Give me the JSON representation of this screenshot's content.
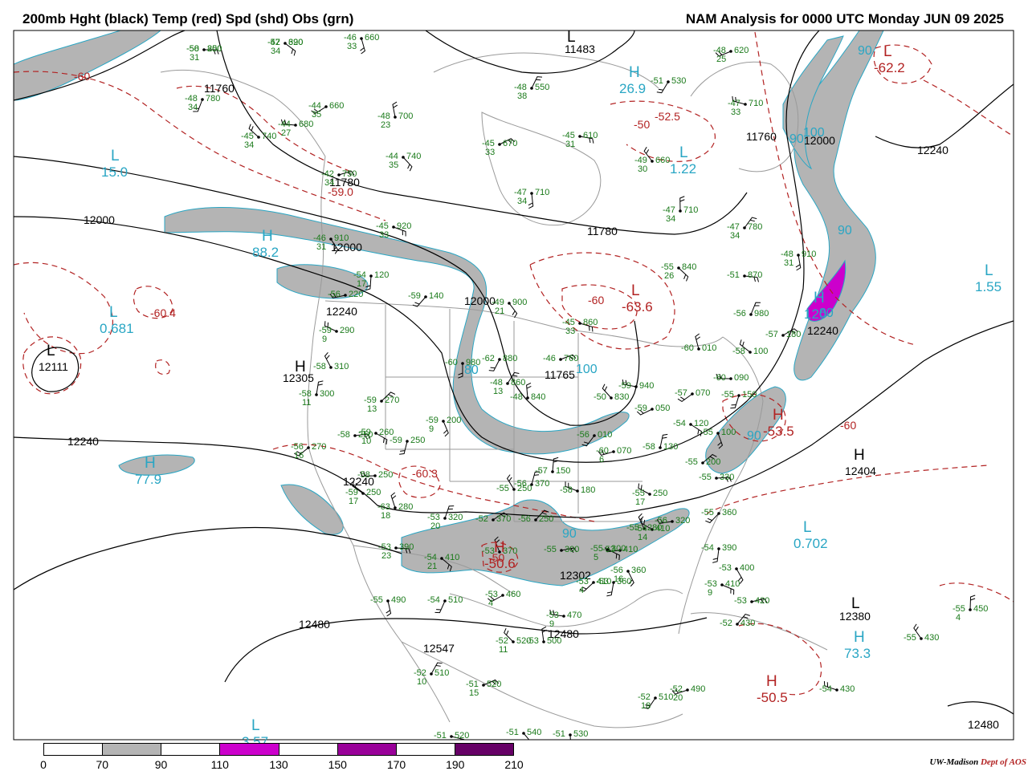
{
  "header": {
    "left": "200mb Hght (black) Temp (red) Spd (shd) Obs (grn)",
    "right": "NAM Analysis for 0000 UTC Monday  JUN 09 2025"
  },
  "legend": {
    "ticks": [
      "0",
      "70",
      "90",
      "110",
      "130",
      "150",
      "170",
      "190",
      "210"
    ],
    "fills": [
      "#ffffff",
      "#b4b4b4",
      "#ffffff",
      "#cc00cc",
      "#ffffff",
      "#990099",
      "#ffffff",
      "#660066"
    ]
  },
  "credit": {
    "org": "UW-Madison",
    "dept": "Dept of AOS"
  },
  "colors": {
    "height": "#000000",
    "temp": "#b22222",
    "speed": "#29a6c4",
    "obs": "#1a7a1a",
    "speed_shade": "#b4b4b4",
    "jet_core": "#cc00cc"
  },
  "height_labels": [
    "11483",
    "11760",
    "11760",
    "11780",
    "11780",
    "12000",
    "12000",
    "12000",
    "12000",
    "12240",
    "12240",
    "12240",
    "12240",
    "12240",
    "12480",
    "12480",
    "12480",
    "12111",
    "12305",
    "12404",
    "12547",
    "12380",
    "11765",
    "12302"
  ],
  "pressure_centers": [
    {
      "type": "H",
      "value": "26.9",
      "kind": "speed"
    },
    {
      "type": "L",
      "value": "15.0",
      "kind": "speed"
    },
    {
      "type": "H",
      "value": "88.2",
      "kind": "speed"
    },
    {
      "type": "L",
      "value": "0.681",
      "kind": "speed"
    },
    {
      "type": "H",
      "value": "77.9",
      "kind": "speed"
    },
    {
      "type": "L",
      "value": "1.22",
      "kind": "speed"
    },
    {
      "type": "L",
      "value": "1.55",
      "kind": "speed"
    },
    {
      "type": "L",
      "value": "0.702",
      "kind": "speed"
    },
    {
      "type": "H",
      "value": "73.3",
      "kind": "speed"
    },
    {
      "type": "H",
      "value": "120",
      "kind": "speed"
    },
    {
      "type": "L",
      "value": "3.57",
      "kind": "speed"
    },
    {
      "type": "L",
      "value": "",
      "kind": "height"
    },
    {
      "type": "H",
      "value": "",
      "kind": "height"
    },
    {
      "type": "H",
      "value": "",
      "kind": "height"
    },
    {
      "type": "L",
      "value": "",
      "kind": "height"
    },
    {
      "type": "L",
      "value": "",
      "kind": "height"
    },
    {
      "type": "L",
      "value": "-63.6",
      "kind": "temp"
    },
    {
      "type": "H",
      "value": "-53.5",
      "kind": "temp"
    },
    {
      "type": "H",
      "value": "-50.6",
      "kind": "temp"
    },
    {
      "type": "H",
      "value": "-50.5",
      "kind": "temp"
    },
    {
      "type": "L",
      "value": "-62.2",
      "kind": "temp"
    }
  ],
  "temp_labels": [
    "-60",
    "-52.5",
    "-50",
    "-60",
    "-60.4",
    "-59.0",
    "-60.3",
    "-60",
    "-50"
  ],
  "speed_labels": [
    "90",
    "90",
    "90",
    "100",
    "100",
    "90",
    "80",
    "80",
    "90"
  ],
  "observations": [
    {
      "t": "-50",
      "s": "31",
      "h": "800"
    },
    {
      "t": "-47",
      "s": "34",
      "h": "690"
    },
    {
      "t": "-46",
      "s": "33",
      "h": "660"
    },
    {
      "t": "-48",
      "s": "34",
      "h": "780"
    },
    {
      "t": "-44",
      "s": "35",
      "h": "660"
    },
    {
      "t": "-44",
      "s": "27",
      "h": "680"
    },
    {
      "t": "-45",
      "s": "34",
      "h": "740"
    },
    {
      "t": "-48",
      "s": "23",
      "h": "700"
    },
    {
      "t": "-48",
      "s": "38",
      "h": "550"
    },
    {
      "t": "-45",
      "s": "33",
      "h": "670"
    },
    {
      "t": "-45",
      "s": "31",
      "h": "610"
    },
    {
      "t": "-44",
      "s": "35",
      "h": "740"
    },
    {
      "t": "-47",
      "s": "34",
      "h": "710"
    },
    {
      "t": "-51",
      "s": "",
      "h": "530"
    },
    {
      "t": "-48",
      "s": "25",
      "h": "620"
    },
    {
      "t": "-47",
      "s": "33",
      "h": "710"
    },
    {
      "t": "-49",
      "s": "30",
      "h": "660"
    },
    {
      "t": "-47",
      "s": "34",
      "h": "710"
    },
    {
      "t": "-47",
      "s": "34",
      "h": "780"
    },
    {
      "t": "-42",
      "s": "34",
      "h": "750"
    },
    {
      "t": "-45",
      "s": "33",
      "h": "920"
    },
    {
      "t": "-46",
      "s": "31",
      "h": "910"
    },
    {
      "t": "-54",
      "s": "17",
      "h": "120"
    },
    {
      "t": "-59",
      "s": "",
      "h": "140"
    },
    {
      "t": "-56",
      "s": "",
      "h": "220"
    },
    {
      "t": "-59",
      "s": "9",
      "h": "290"
    },
    {
      "t": "-58",
      "s": "",
      "h": "310"
    },
    {
      "t": "-58",
      "s": "11",
      "h": "300"
    },
    {
      "t": "-59",
      "s": "13",
      "h": "270"
    },
    {
      "t": "-58",
      "s": "",
      "h": "250"
    },
    {
      "t": "-59",
      "s": "10",
      "h": "260"
    },
    {
      "t": "-59",
      "s": "9",
      "h": "200"
    },
    {
      "t": "-59",
      "s": "",
      "h": "250"
    },
    {
      "t": "-56",
      "s": "16",
      "h": "270"
    },
    {
      "t": "-58",
      "s": "",
      "h": "250"
    },
    {
      "t": "-59",
      "s": "17",
      "h": "250"
    },
    {
      "t": "-63",
      "s": "18",
      "h": "280"
    },
    {
      "t": "-53",
      "s": "20",
      "h": "320"
    },
    {
      "t": "-52",
      "s": "",
      "h": "370"
    },
    {
      "t": "-53",
      "s": "23",
      "h": "390"
    },
    {
      "t": "-54",
      "s": "21",
      "h": "410"
    },
    {
      "t": "-55",
      "s": "",
      "h": "490"
    },
    {
      "t": "-54",
      "s": "",
      "h": "510"
    },
    {
      "t": "-53",
      "s": "4",
      "h": "460"
    },
    {
      "t": "-53",
      "s": "9",
      "h": "470"
    },
    {
      "t": "-52",
      "s": "11",
      "h": "520"
    },
    {
      "t": "-53",
      "s": "",
      "h": "500"
    },
    {
      "t": "-52",
      "s": "10",
      "h": "510"
    },
    {
      "t": "-51",
      "s": "15",
      "h": "520"
    },
    {
      "t": "-51",
      "s": "",
      "h": "520"
    },
    {
      "t": "-51",
      "s": "",
      "h": "540"
    },
    {
      "t": "-51",
      "s": "",
      "h": "530"
    },
    {
      "t": "-52",
      "s": "18",
      "h": "510"
    },
    {
      "t": "-52",
      "s": "20",
      "h": "490"
    },
    {
      "t": "-54",
      "s": "",
      "h": "430"
    },
    {
      "t": "-55",
      "s": "",
      "h": "430"
    },
    {
      "t": "-55",
      "s": "4",
      "h": "450"
    },
    {
      "t": "-52",
      "s": "",
      "h": "430"
    },
    {
      "t": "-53",
      "s": "",
      "h": "420"
    },
    {
      "t": "-53",
      "s": "9",
      "h": "410"
    },
    {
      "t": "-53",
      "s": "",
      "h": "400"
    },
    {
      "t": "-54",
      "s": "",
      "h": "390"
    },
    {
      "t": "-55",
      "s": "",
      "h": "360"
    },
    {
      "t": "-56",
      "s": "",
      "h": "320"
    },
    {
      "t": "-55",
      "s": "17",
      "h": "250"
    },
    {
      "t": "-55",
      "s": "",
      "h": "280"
    },
    {
      "t": "-58",
      "s": "",
      "h": "130"
    },
    {
      "t": "-55",
      "s": "",
      "h": "200"
    },
    {
      "t": "-55",
      "s": "",
      "h": "330"
    },
    {
      "t": "-54",
      "s": "",
      "h": "120"
    },
    {
      "t": "-55",
      "s": "",
      "h": "100"
    },
    {
      "t": "-55",
      "s": "",
      "h": "150"
    },
    {
      "t": "-57",
      "s": "",
      "h": "070"
    },
    {
      "t": "-60",
      "s": "",
      "h": "090"
    },
    {
      "t": "-58",
      "s": "",
      "h": "100"
    },
    {
      "t": "-60",
      "s": "",
      "h": "010"
    },
    {
      "t": "-56",
      "s": "",
      "h": "980"
    },
    {
      "t": "-57",
      "s": "",
      "h": "180"
    },
    {
      "t": "-51",
      "s": "",
      "h": "870"
    },
    {
      "t": "-55",
      "s": "26",
      "h": "840"
    },
    {
      "t": "-48",
      "s": "31",
      "h": "910"
    },
    {
      "t": "-62",
      "s": "",
      "h": "880"
    },
    {
      "t": "-59",
      "s": "",
      "h": "050"
    },
    {
      "t": "-59",
      "s": "",
      "h": "940"
    },
    {
      "t": "-50",
      "s": "",
      "h": "830"
    },
    {
      "t": "-48",
      "s": "",
      "h": "840"
    },
    {
      "t": "-48",
      "s": "13",
      "h": "860"
    },
    {
      "t": "-46",
      "s": "",
      "h": "760"
    },
    {
      "t": "-45",
      "s": "33",
      "h": "860"
    },
    {
      "t": "-49",
      "s": "21",
      "h": "900"
    },
    {
      "t": "-60",
      "s": "",
      "h": "980"
    },
    {
      "t": "-56",
      "s": "",
      "h": "010"
    },
    {
      "t": "-60",
      "s": "6",
      "h": "070"
    },
    {
      "t": "-58",
      "s": "",
      "h": "180"
    },
    {
      "t": "-55",
      "s": "",
      "h": "250"
    },
    {
      "t": "-57",
      "s": "",
      "h": "150"
    },
    {
      "t": "-56",
      "s": "",
      "h": "250"
    },
    {
      "t": "-55",
      "s": "",
      "h": "300"
    },
    {
      "t": "-55",
      "s": "5",
      "h": "300"
    },
    {
      "t": "-56",
      "s": "16",
      "h": "360"
    },
    {
      "t": "-53",
      "s": "",
      "h": "360"
    },
    {
      "t": "-53",
      "s": "4",
      "h": "410"
    },
    {
      "t": "-53",
      "s": "",
      "h": "410"
    },
    {
      "t": "-54",
      "s": "14",
      "h": "410"
    },
    {
      "t": "-53",
      "s": "",
      "h": "370"
    },
    {
      "t": "-56",
      "s": "",
      "h": "370"
    },
    {
      "t": "-58",
      "s": "",
      "h": "250"
    },
    {
      "t": "-52",
      "s": "",
      "h": "320"
    }
  ]
}
